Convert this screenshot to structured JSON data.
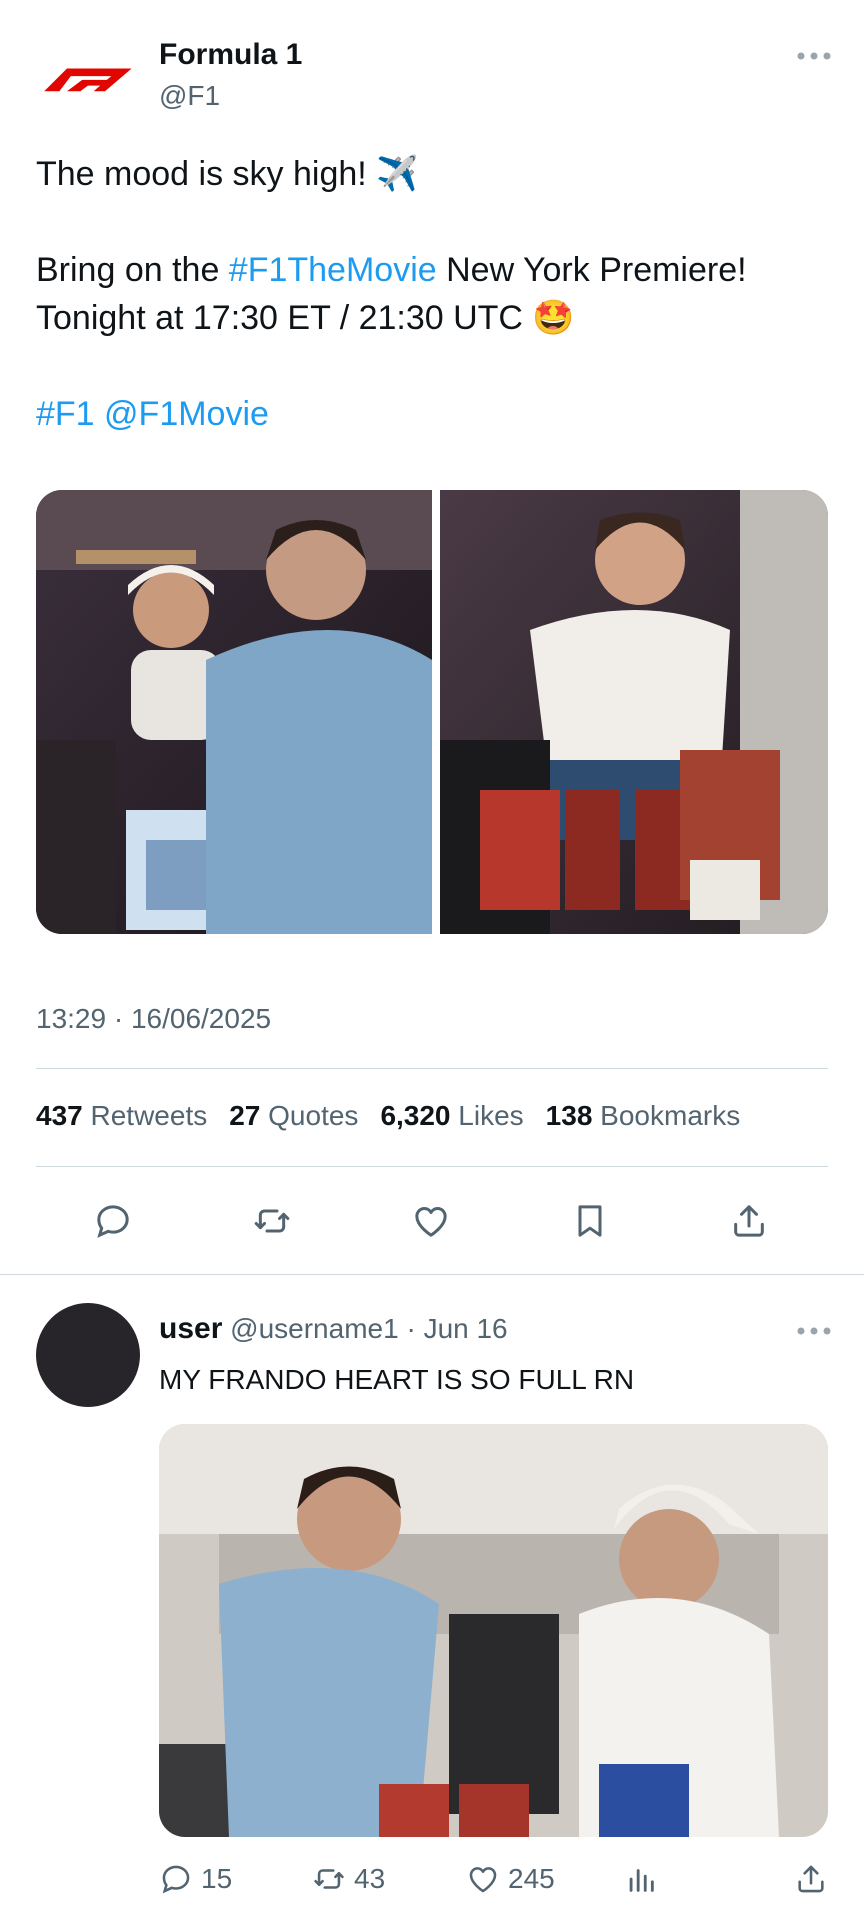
{
  "tweet": {
    "author_name": "Formula 1",
    "author_handle": "@F1",
    "text_line1": "The mood is sky high! ✈️",
    "text_line2_prefix": "Bring on the ",
    "text_line2_hashtag": "#F1TheMovie",
    "text_line2_suffix": " New York Premiere!",
    "text_line3": "Tonight at 17:30 ET / 21:30 UTC 🤩",
    "tag_f1": "#F1",
    "mention_f1movie": "@F1Movie",
    "timestamp": "13:29 · 16/06/2025",
    "stats": {
      "retweets_count": "437",
      "retweets_label": "Retweets",
      "quotes_count": "27",
      "quotes_label": "Quotes",
      "likes_count": "6,320",
      "likes_label": "Likes",
      "bookmarks_count": "138",
      "bookmarks_label": "Bookmarks"
    }
  },
  "reply": {
    "name": "user",
    "handle": "@username1",
    "sep": " · ",
    "date": "Jun 16",
    "text": "MY FRANDO HEART IS SO FULL RN",
    "reply_count": "15",
    "retweet_count": "43",
    "like_count": "245"
  },
  "colors": {
    "accent": "#1d9bf0",
    "f1_red": "#e10600",
    "muted": "#536471",
    "divider": "#cfd9de"
  },
  "icons": [
    "f1-logo-icon",
    "more-icon",
    "reply-icon",
    "retweet-icon",
    "like-icon",
    "bookmark-icon",
    "share-icon",
    "views-icon"
  ]
}
